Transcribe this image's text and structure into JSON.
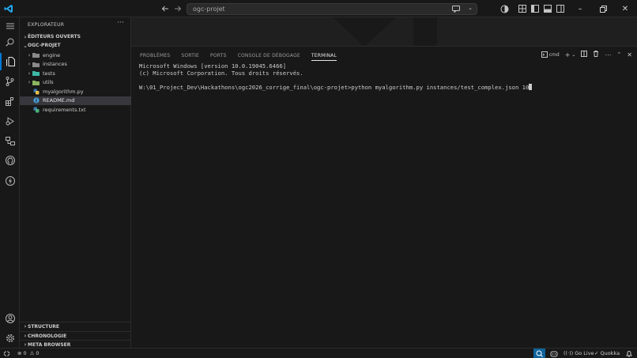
{
  "titlebar": {
    "search_text": "ogc-projet"
  },
  "sidebar": {
    "header": "EXPLORATEUR",
    "open_editors": "ÉDITEURS OUVERTS",
    "project": "OGC-PROJET",
    "items": [
      {
        "label": "engine",
        "type": "folder"
      },
      {
        "label": "instances",
        "type": "folder"
      },
      {
        "label": "tests",
        "type": "folder"
      },
      {
        "label": "utils",
        "type": "folder"
      },
      {
        "label": "myalgorithm.py",
        "type": "file"
      },
      {
        "label": "README.md",
        "type": "file"
      },
      {
        "label": "requirements.txt",
        "type": "file"
      }
    ],
    "bottom_sections": [
      "STRUCTURE",
      "CHRONOLOGIE",
      "META BROWSER"
    ]
  },
  "panel": {
    "tabs": [
      "PROBLÈMES",
      "SORTIE",
      "PORTS",
      "CONSOLE DE DÉBOGAGE",
      "TERMINAL"
    ],
    "active_tab": "TERMINAL",
    "terminal_name": "cmd",
    "terminal_lines": [
      "Microsoft Windows [version 10.0.19045.6466]",
      "(c) Microsoft Corporation. Tous droits réservés.",
      "",
      "W:\\01_Project_Dev\\Hackathons\\ogc2026_corrige_final\\ogc-projet>python myalgorithm.py instances/test_complex.json 10"
    ]
  },
  "statusbar": {
    "errors": "0",
    "warnings": "0",
    "go_live": "Go Live",
    "quokka": "Quokka"
  },
  "colors": {
    "accent": "#0078d4",
    "status_highlight": "#0e639c",
    "folder_green": "#49b27a",
    "python_yellow": "#e8c04a",
    "readme_blue": "#4a9cd6"
  }
}
